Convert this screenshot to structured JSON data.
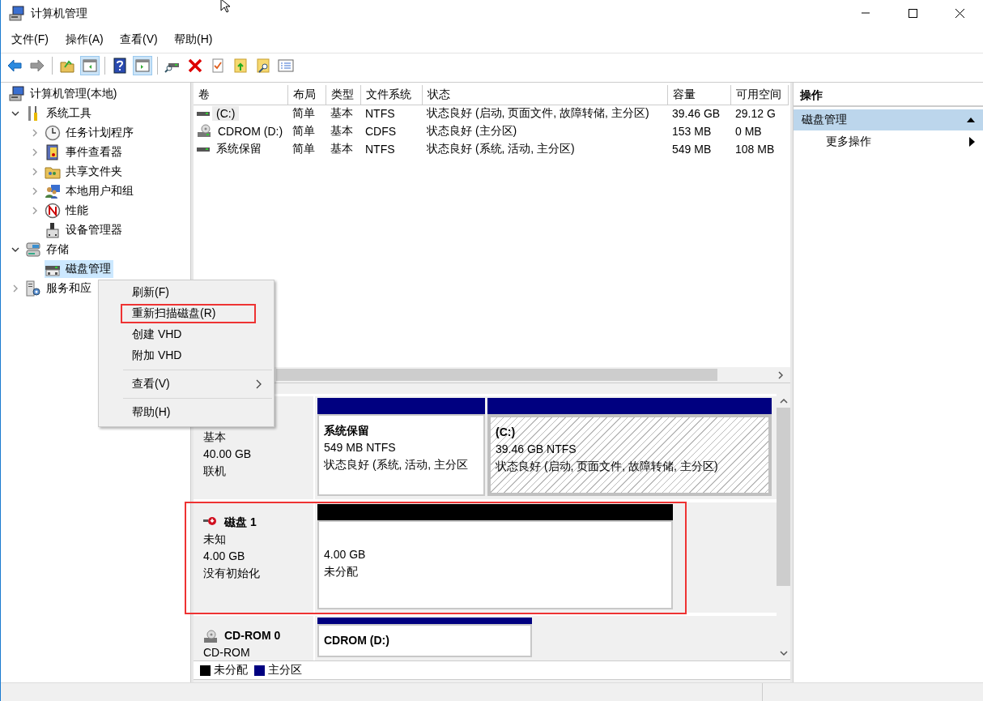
{
  "window": {
    "title": "计算机管理"
  },
  "menu": [
    "文件(F)",
    "操作(A)",
    "查看(V)",
    "帮助(H)"
  ],
  "toolbar": [
    [
      {
        "kind": "back",
        "disabled": false,
        "pressed": false
      },
      {
        "kind": "forward",
        "disabled": true,
        "pressed": false
      }
    ],
    [
      {
        "kind": "up-folder",
        "disabled": false,
        "pressed": false
      },
      {
        "kind": "console-tree",
        "disabled": false,
        "pressed": true
      }
    ],
    [
      {
        "kind": "help",
        "disabled": false,
        "pressed": false
      },
      {
        "kind": "action-pane",
        "disabled": false,
        "pressed": true
      }
    ],
    [
      {
        "kind": "connect",
        "disabled": false,
        "pressed": false
      },
      {
        "kind": "delete",
        "disabled": false,
        "pressed": false
      },
      {
        "kind": "check",
        "disabled": false,
        "pressed": false
      },
      {
        "kind": "folder-up",
        "disabled": false,
        "pressed": false
      },
      {
        "kind": "folder-search",
        "disabled": false,
        "pressed": false
      },
      {
        "kind": "list",
        "disabled": false,
        "pressed": false
      }
    ]
  ],
  "tree": {
    "label": "计算机管理(本地)",
    "kind": "computer",
    "selected": false,
    "children": [
      {
        "label": "系统工具",
        "kind": "tools",
        "selected": false,
        "expanded": true,
        "children": [
          {
            "label": "任务计划程序",
            "kind": "clock",
            "selected": false,
            "expanded": false
          },
          {
            "label": "事件查看器",
            "kind": "log",
            "selected": false,
            "expanded": false
          },
          {
            "label": "共享文件夹",
            "kind": "share",
            "selected": false,
            "expanded": false
          },
          {
            "label": "本地用户和组",
            "kind": "users",
            "selected": false,
            "expanded": false
          },
          {
            "label": "性能",
            "kind": "perf",
            "selected": false,
            "expanded": false
          },
          {
            "label": "设备管理器",
            "kind": "device",
            "selected": false
          }
        ]
      },
      {
        "label": "存储",
        "kind": "storage",
        "selected": false,
        "expanded": true,
        "children": [
          {
            "label": "磁盘管理",
            "kind": "disk",
            "selected": true
          }
        ]
      },
      {
        "label": "服务和应",
        "kind": "services",
        "selected": false,
        "expanded": false
      }
    ]
  },
  "volumes": {
    "columns": [
      "卷",
      "布局",
      "类型",
      "文件系统",
      "状态",
      "容量",
      "可用空间"
    ],
    "rows": [
      {
        "kind": "drive",
        "selected": true,
        "cells": [
          "(C:)",
          "简单",
          "基本",
          "NTFS",
          "状态良好 (启动, 页面文件, 故障转储, 主分区)",
          "39.46 GB",
          "29.12 G"
        ]
      },
      {
        "kind": "cdrom",
        "selected": false,
        "cells": [
          "CDROM (D:)",
          "简单",
          "基本",
          "CDFS",
          "状态良好 (主分区)",
          "153 MB",
          "0 MB"
        ]
      },
      {
        "kind": "drive",
        "selected": false,
        "cells": [
          "系统保留",
          "简单",
          "基本",
          "NTFS",
          "状态良好 (系统, 活动, 主分区)",
          "549 MB",
          "108 MB"
        ]
      }
    ]
  },
  "disks": [
    {
      "kind": "basic",
      "lines": [
        "基本",
        "40.00 GB",
        "联机"
      ],
      "highlighted": false,
      "partitions": [
        {
          "kind": "primary",
          "title": "系统保留",
          "lines": [
            "549 MB NTFS",
            "状态良好 (系统, 活动, 主分区"
          ],
          "selected": false
        },
        {
          "kind": "primary",
          "title": "(C:)",
          "lines": [
            "39.46 GB NTFS",
            "状态良好 (启动, 页面文件, 故障转储, 主分区)"
          ],
          "selected": true
        }
      ]
    },
    {
      "kind": "unknown",
      "name": "磁盘 1",
      "lines": [
        "未知",
        "4.00 GB",
        "没有初始化"
      ],
      "highlighted": true,
      "partitions": [
        {
          "kind": "unallocated",
          "lines": [
            "4.00 GB",
            "未分配"
          ],
          "selected": false
        }
      ]
    },
    {
      "kind": "cdrom",
      "name": "CD-ROM 0",
      "lines": [
        "CD-ROM"
      ],
      "highlighted": false,
      "partitions": [
        {
          "kind": "primary",
          "title": "CDROM (D:)",
          "selected": false
        }
      ]
    }
  ],
  "legend": [
    {
      "label": "未分配",
      "color": "#000000"
    },
    {
      "label": "主分区",
      "color": "#000080"
    }
  ],
  "actions": {
    "title": "操作",
    "sections": [
      {
        "label": "磁盘管理",
        "expanded": true,
        "items": [
          {
            "label": "更多操作",
            "submenu": true
          }
        ]
      }
    ]
  },
  "context_menu": {
    "items": [
      {
        "label": "刷新(F)",
        "highlighted": false,
        "submenu": false,
        "divider_before": false
      },
      {
        "label": "重新扫描磁盘(R)",
        "highlighted": true,
        "submenu": false,
        "divider_before": false
      },
      {
        "label": "创建 VHD",
        "highlighted": false,
        "submenu": false,
        "divider_before": false
      },
      {
        "label": "附加 VHD",
        "highlighted": false,
        "submenu": false,
        "divider_before": false
      },
      {
        "label": "查看(V)",
        "highlighted": false,
        "submenu": true,
        "divider_before": true
      },
      {
        "label": "帮助(H)",
        "highlighted": false,
        "submenu": false,
        "divider_before": true
      }
    ]
  }
}
